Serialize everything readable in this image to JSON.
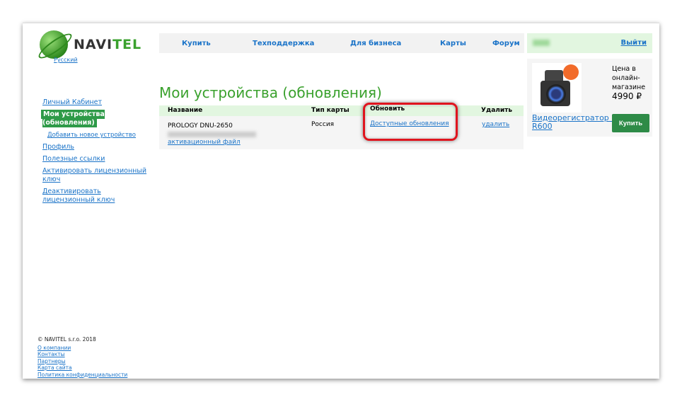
{
  "header": {
    "logo": "NAVITEL",
    "language": "Русский",
    "nav": [
      "Купить",
      "Техподдержка",
      "Для бизнеса",
      "Карты",
      "Форум"
    ],
    "logout": "Выйти"
  },
  "sidebar": {
    "items": [
      {
        "label": "Личный Кабинет"
      },
      {
        "label": "Мои устройства (обновления)"
      },
      {
        "label": "Добавить новое устройство"
      },
      {
        "label": "Профиль"
      },
      {
        "label": "Полезные ссылки"
      },
      {
        "label": "Активировать лицензионный ключ"
      },
      {
        "label": "Деактивировать лицензионный ключ"
      }
    ]
  },
  "main": {
    "title": "Мои устройства (обновления)",
    "columns": [
      "Название",
      "Тип карты",
      "Обновить",
      "Удалить"
    ],
    "row": {
      "device": "PROLOGY DNU-2650",
      "activation": "активационный файл",
      "map": "Россия",
      "update": "Доступные обновления",
      "delete": "удалить"
    }
  },
  "promo": {
    "price_label": "Цена в онлайн-магазине",
    "price": "4990 ₽",
    "product": "Видеорегистратор NAVITEL R600",
    "buy": "Купить"
  },
  "footer": {
    "copyright": "© NAVITEL s.r.o. 2018",
    "links": [
      "О компании",
      "Контакты",
      "Партнеры",
      "Карта сайта",
      "Политика конфиденциальности"
    ]
  }
}
